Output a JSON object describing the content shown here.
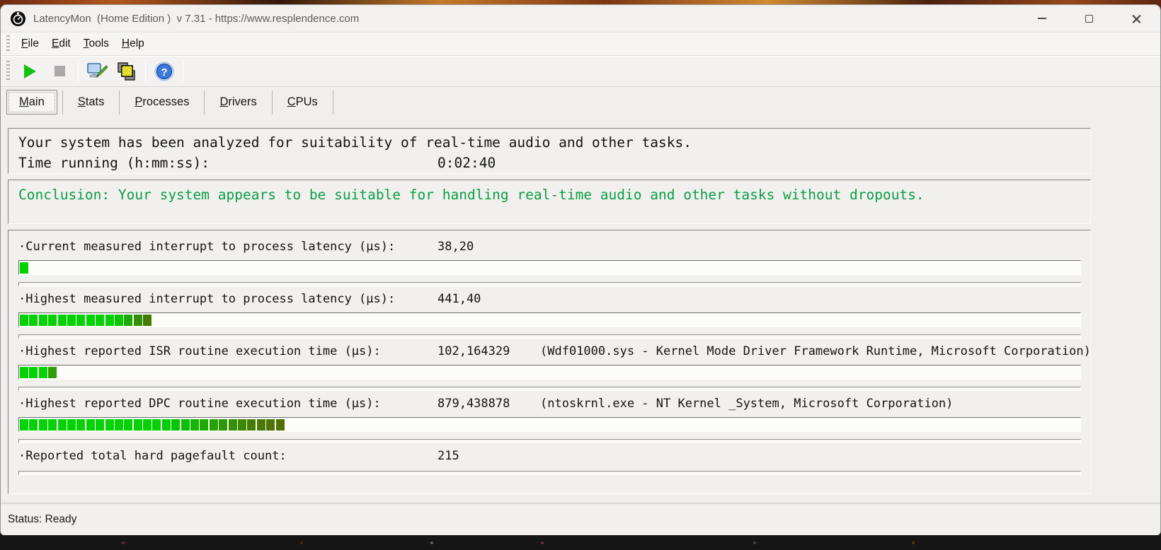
{
  "window": {
    "title": "LatencyMon  (Home Edition )  v 7.31 - https://www.resplendence.com"
  },
  "menu": {
    "items": [
      "File",
      "Edit",
      "Tools",
      "Help"
    ]
  },
  "toolbar": {
    "buttons": [
      {
        "name": "start-button",
        "icon": "play-icon"
      },
      {
        "name": "stop-button",
        "icon": "stop-icon"
      },
      {
        "name": "options-button",
        "icon": "monitor-pen-icon"
      },
      {
        "name": "report-button",
        "icon": "layered-squares-icon"
      },
      {
        "name": "help-button",
        "icon": "question-mark-icon"
      }
    ],
    "help_glyph": "?"
  },
  "tabs": {
    "active": "Main",
    "items": [
      "Main",
      "Stats",
      "Processes",
      "Drivers",
      "CPUs"
    ]
  },
  "analysis_panel": {
    "line1": "Your system has been analyzed for suitability of real-time audio and other tasks.",
    "time_label": "Time running (h:mm:ss):",
    "time_value": "0:02:40"
  },
  "conclusion_panel": {
    "text": "Conclusion: Your system appears to be suitable for handling real-time audio and other tasks without dropouts.",
    "text_color": "#0a9e44"
  },
  "metrics_panel": {
    "rows": [
      {
        "label": "·Current measured interrupt to process latency (µs):",
        "value": "38,20",
        "extra": "",
        "bar": {
          "segments": [
            "#04d204"
          ]
        }
      },
      {
        "label": "·Highest measured interrupt to process latency (µs):",
        "value": "441,40",
        "extra": "",
        "bar": {
          "segments": [
            "#04d204",
            "#04d204",
            "#04d204",
            "#04d204",
            "#04d204",
            "#04d204",
            "#04d204",
            "#04d204",
            "#04d204",
            "#04d204",
            "#08c704",
            "#1cab04",
            "#339104",
            "#457a04"
          ]
        }
      },
      {
        "label": "·Highest reported ISR routine execution time (µs):",
        "value": "102,164329",
        "extra": "(Wdf01000.sys - Kernel Mode Driver Framework Runtime, Microsoft Corporation)",
        "bar": {
          "segments": [
            "#04d204",
            "#04d204",
            "#04d204",
            "#2f9e04"
          ]
        }
      },
      {
        "label": "·Highest reported DPC routine execution time (µs):",
        "value": "879,438878",
        "extra": "(ntoskrnl.exe - NT Kernel _System, Microsoft Corporation)",
        "bar": {
          "segments": [
            "#04d204",
            "#04d204",
            "#04d204",
            "#04d204",
            "#04d204",
            "#04d204",
            "#04d204",
            "#04d204",
            "#04d204",
            "#04d204",
            "#04d204",
            "#04d204",
            "#04d204",
            "#04d204",
            "#04d204",
            "#04cd04",
            "#04c604",
            "#0cbe04",
            "#14b504",
            "#1cab04",
            "#24a204",
            "#2c9904",
            "#349004",
            "#3c8704",
            "#437e04",
            "#497804",
            "#4d7404",
            "#517004"
          ]
        }
      },
      {
        "label": "·Reported total hard pagefault count:",
        "value": "215",
        "extra": "",
        "bar": null
      }
    ]
  },
  "status_bar": {
    "text": "Status: Ready"
  },
  "colors": {
    "bar_green_bright": "#04d204",
    "bar_green_dark": "#517004",
    "window_bg": "#f0efed"
  }
}
